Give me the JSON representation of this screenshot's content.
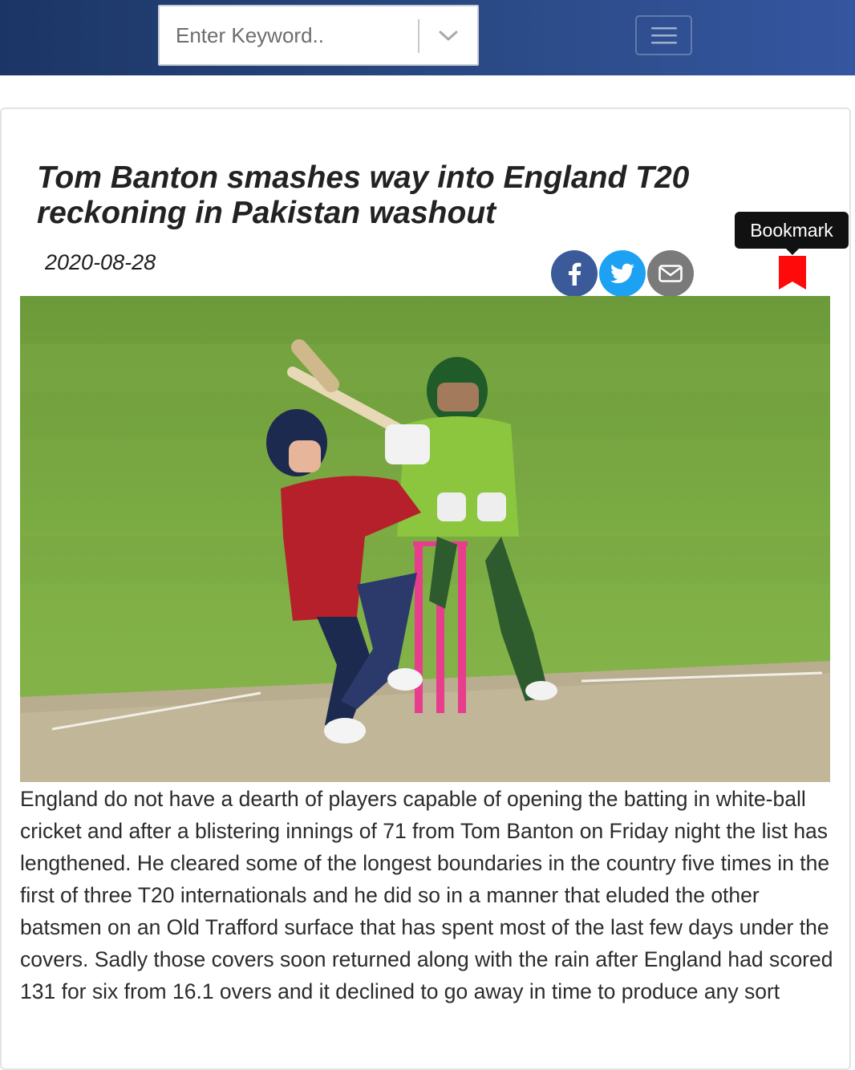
{
  "header": {
    "search": {
      "placeholder": "Enter Keyword..",
      "dropdown_icon": "chevron-down-icon"
    },
    "menu_icon": "hamburger-menu-icon",
    "gradient_colors": [
      "#1c3566",
      "#3556a0"
    ]
  },
  "article": {
    "title": "Tom Banton smashes way into England T20 reckoning in Pakistan washout",
    "date": "2020-08-28",
    "share": {
      "facebook_icon": "facebook-icon",
      "twitter_icon": "twitter-icon",
      "email_icon": "email-icon"
    },
    "bookmark": {
      "tooltip": "Bookmark",
      "icon": "bookmark-icon",
      "color": "#ff0000"
    },
    "image": {
      "alt": "Tom Banton batting with Pakistan wicketkeeper behind"
    },
    "body": "England do not have a dearth of players capable of opening the batting in white-ball cricket and after a blistering innings of 71 from Tom Banton on Friday night the list has lengthened. He cleared some of the longest boundaries in the country five times in the first of three T20 internationals and he did so in a manner that eluded the other batsmen on an Old Trafford surface that has spent most of the last few days under the covers. Sadly those covers soon returned along with the rain after England had scored 131 for six from 16.1 overs and it declined to go away in time to produce any sort"
  }
}
